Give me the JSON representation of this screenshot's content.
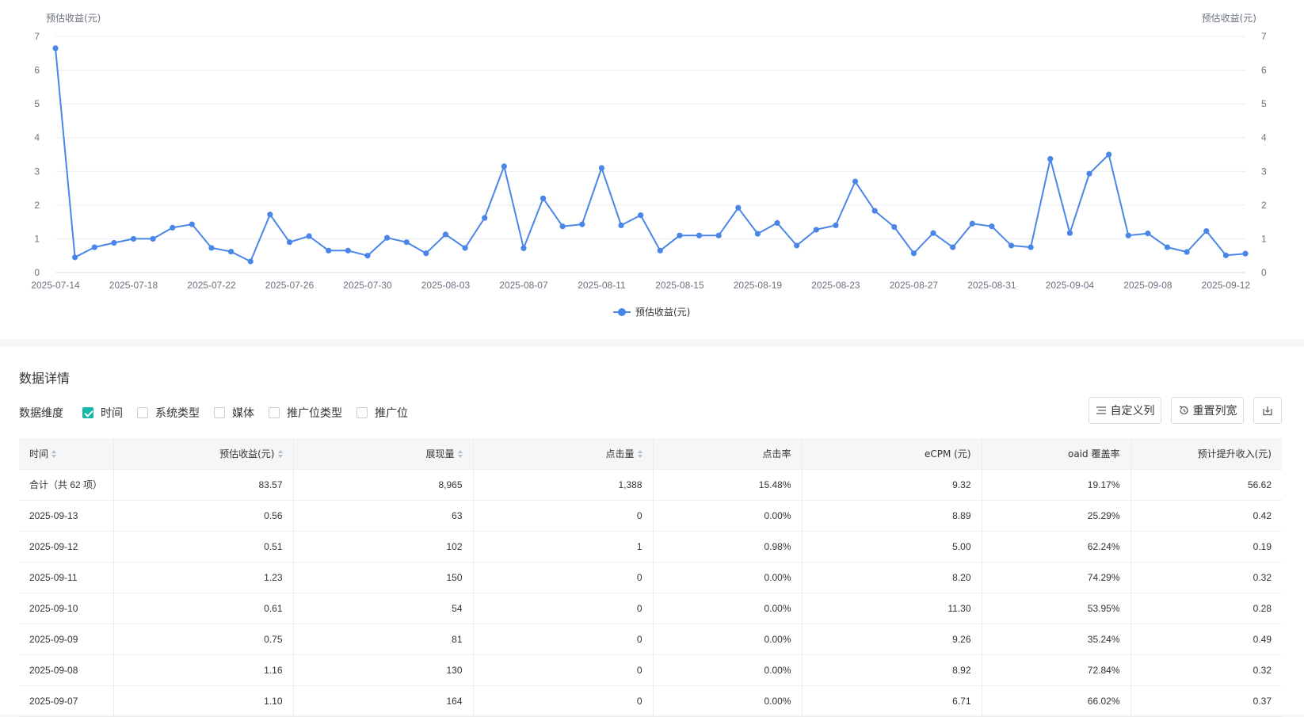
{
  "chart_data": {
    "type": "line",
    "axis_title_left": "预估收益(元)",
    "axis_title_right": "预估收益(元)",
    "ylim": [
      0,
      7
    ],
    "yticks": [
      0,
      1,
      2,
      3,
      4,
      5,
      6,
      7
    ],
    "x_tick_labels": [
      "2025-07-14",
      "2025-07-18",
      "2025-07-22",
      "2025-07-26",
      "2025-07-30",
      "2025-08-03",
      "2025-08-07",
      "2025-08-11",
      "2025-08-15",
      "2025-08-19",
      "2025-08-23",
      "2025-08-27",
      "2025-08-31",
      "2025-09-04",
      "2025-09-08",
      "2025-09-12"
    ],
    "x": [
      "2025-07-14",
      "2025-07-15",
      "2025-07-16",
      "2025-07-17",
      "2025-07-18",
      "2025-07-19",
      "2025-07-20",
      "2025-07-21",
      "2025-07-22",
      "2025-07-23",
      "2025-07-24",
      "2025-07-25",
      "2025-07-26",
      "2025-07-27",
      "2025-07-28",
      "2025-07-29",
      "2025-07-30",
      "2025-07-31",
      "2025-08-01",
      "2025-08-02",
      "2025-08-03",
      "2025-08-04",
      "2025-08-05",
      "2025-08-06",
      "2025-08-07",
      "2025-08-08",
      "2025-08-09",
      "2025-08-10",
      "2025-08-11",
      "2025-08-12",
      "2025-08-13",
      "2025-08-14",
      "2025-08-15",
      "2025-08-16",
      "2025-08-17",
      "2025-08-18",
      "2025-08-19",
      "2025-08-20",
      "2025-08-21",
      "2025-08-22",
      "2025-08-23",
      "2025-08-24",
      "2025-08-25",
      "2025-08-26",
      "2025-08-27",
      "2025-08-28",
      "2025-08-29",
      "2025-08-30",
      "2025-08-31",
      "2025-09-01",
      "2025-09-02",
      "2025-09-03",
      "2025-09-04",
      "2025-09-05",
      "2025-09-06",
      "2025-09-07",
      "2025-09-08",
      "2025-09-09",
      "2025-09-10",
      "2025-09-11",
      "2025-09-12",
      "2025-09-13"
    ],
    "series": [
      {
        "name": "预估收益(元)",
        "color": "#4a86e8",
        "values": [
          6.65,
          0.45,
          0.75,
          0.88,
          1.0,
          1.0,
          1.33,
          1.43,
          0.73,
          0.62,
          0.33,
          1.72,
          0.9,
          1.08,
          0.65,
          0.65,
          0.5,
          1.03,
          0.9,
          0.57,
          1.13,
          0.73,
          1.62,
          3.15,
          0.72,
          2.2,
          1.37,
          1.43,
          3.1,
          1.4,
          1.7,
          0.65,
          1.1,
          1.1,
          1.1,
          1.92,
          1.15,
          1.47,
          0.8,
          1.27,
          1.4,
          2.7,
          1.83,
          1.35,
          0.57,
          1.17,
          0.75,
          1.45,
          1.37,
          0.8,
          0.75,
          3.37,
          1.17,
          2.93,
          3.5,
          1.1,
          1.16,
          0.75,
          0.61,
          1.23,
          0.51,
          0.56
        ]
      }
    ],
    "grid": true,
    "legend_position": "bottom-center"
  },
  "details": {
    "title": "数据详情",
    "dimension_label": "数据维度",
    "dimensions": [
      {
        "label": "时间",
        "checked": true
      },
      {
        "label": "系统类型",
        "checked": false
      },
      {
        "label": "媒体",
        "checked": false
      },
      {
        "label": "推广位类型",
        "checked": false
      },
      {
        "label": "推广位",
        "checked": false
      }
    ],
    "buttons": {
      "custom_columns": "自定义列",
      "reset_width": "重置列宽"
    },
    "columns": [
      "时间",
      "预估收益(元)",
      "展现量",
      "点击量",
      "点击率",
      "eCPM (元)",
      "oaid 覆盖率",
      "预计提升收入(元)"
    ],
    "total_row": [
      "合计（共 62 项）",
      "83.57",
      "8,965",
      "1,388",
      "15.48%",
      "9.32",
      "19.17%",
      "56.62"
    ],
    "rows": [
      [
        "2025-09-13",
        "0.56",
        "63",
        "0",
        "0.00%",
        "8.89",
        "25.29%",
        "0.42"
      ],
      [
        "2025-09-12",
        "0.51",
        "102",
        "1",
        "0.98%",
        "5.00",
        "62.24%",
        "0.19"
      ],
      [
        "2025-09-11",
        "1.23",
        "150",
        "0",
        "0.00%",
        "8.20",
        "74.29%",
        "0.32"
      ],
      [
        "2025-09-10",
        "0.61",
        "54",
        "0",
        "0.00%",
        "11.30",
        "53.95%",
        "0.28"
      ],
      [
        "2025-09-09",
        "0.75",
        "81",
        "0",
        "0.00%",
        "9.26",
        "35.24%",
        "0.49"
      ],
      [
        "2025-09-08",
        "1.16",
        "130",
        "0",
        "0.00%",
        "8.92",
        "72.84%",
        "0.32"
      ],
      [
        "2025-09-07",
        "1.10",
        "164",
        "0",
        "0.00%",
        "6.71",
        "66.02%",
        "0.37"
      ]
    ]
  }
}
